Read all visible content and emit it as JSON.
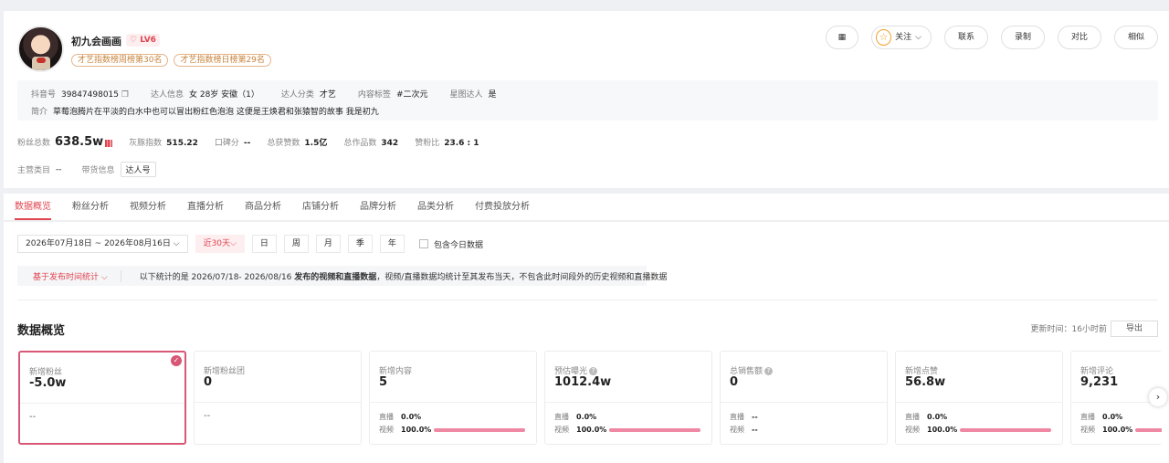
{
  "profile": {
    "name": "初九会画画",
    "level": "LV6",
    "rank_tags": [
      "才艺指数榜周榜第30名",
      "才艺指数榜日榜第29名"
    ]
  },
  "actions": {
    "follow": "关注",
    "contact": "联系",
    "record": "录制",
    "compare": "对比",
    "similar": "相似"
  },
  "info": {
    "douyin_id_label": "抖音号",
    "douyin_id": "39847498015",
    "talent_label": "达人信息",
    "talent": "女 28岁 安徽（1）",
    "category_label": "达人分类",
    "category": "才艺",
    "content_tag_label": "内容标签",
    "content_tag": "#二次元",
    "star_label": "星图达人",
    "star": "是",
    "bio_label": "简介",
    "bio": "草莓泡腾片在平淡的白水中也可以冒出粉红色泡泡 这便是王焕君和张猿智的故事 我是初九"
  },
  "stats": {
    "fans_label": "粉丝总数",
    "fans": "638.5w",
    "index_label": "灰豚指数",
    "index": "515.22",
    "rep_label": "口碑分",
    "rep": "--",
    "likes_label": "总获赞数",
    "likes": "1.5亿",
    "works_label": "总作品数",
    "works": "342",
    "ratio_label": "赞粉比",
    "ratio": "23.6 : 1"
  },
  "categories": {
    "main_label": "主营类目",
    "main": "--",
    "goods_label": "带货信息",
    "goods_tag": "达人号"
  },
  "tabs": [
    "数据概览",
    "粉丝分析",
    "视频分析",
    "直播分析",
    "商品分析",
    "店铺分析",
    "品牌分析",
    "品类分析",
    "付费投放分析"
  ],
  "filter": {
    "date_range": "2026年07月18日 ~ 2026年08月16日 ⌵",
    "recent": "近30天⌵",
    "segments": [
      "日",
      "周",
      "月",
      "季",
      "年"
    ],
    "include_today": "包含今日数据"
  },
  "note": {
    "selector": "基于发布时间统计 ⌵",
    "prefix": "以下统计的是 2026/07/18- 2026/08/16",
    "bold": "发布的视频和直播数据",
    "suffix": "，视频/直播数据均统计至其发布当天，不包含此时间段外的历史视频和直播数据"
  },
  "overview": {
    "title": "数据概览",
    "update_time": "更新时间：16小时前",
    "export": "导出"
  },
  "cards": [
    {
      "label": "新增粉丝",
      "value": "-5.0w",
      "dash": "--"
    },
    {
      "label": "新增粉丝团",
      "value": "0",
      "dash": "--"
    },
    {
      "label": "新增内容",
      "value": "5",
      "live_label": "直播",
      "live": "0.0%",
      "video_label": "视频",
      "video": "100.0%"
    },
    {
      "label": "预估曝光",
      "value": "1012.4w",
      "live_label": "直播",
      "live": "0.0%",
      "video_label": "视频",
      "video": "100.0%"
    },
    {
      "label": "总销售额",
      "value": "0",
      "live_label": "直播",
      "live": "--",
      "video_label": "视频",
      "video": "--"
    },
    {
      "label": "新增点赞",
      "value": "56.8w",
      "live_label": "直播",
      "live": "0.0%",
      "video_label": "视频",
      "video": "100.0%"
    },
    {
      "label": "新增评论",
      "value": "9,231",
      "live_label": "直播",
      "live": "0.0%",
      "video_label": "视频",
      "video": "100.0%"
    }
  ],
  "colors": {
    "accent": "#e0444f",
    "bar": "#ef88a2",
    "selected_border": "#d85775"
  }
}
